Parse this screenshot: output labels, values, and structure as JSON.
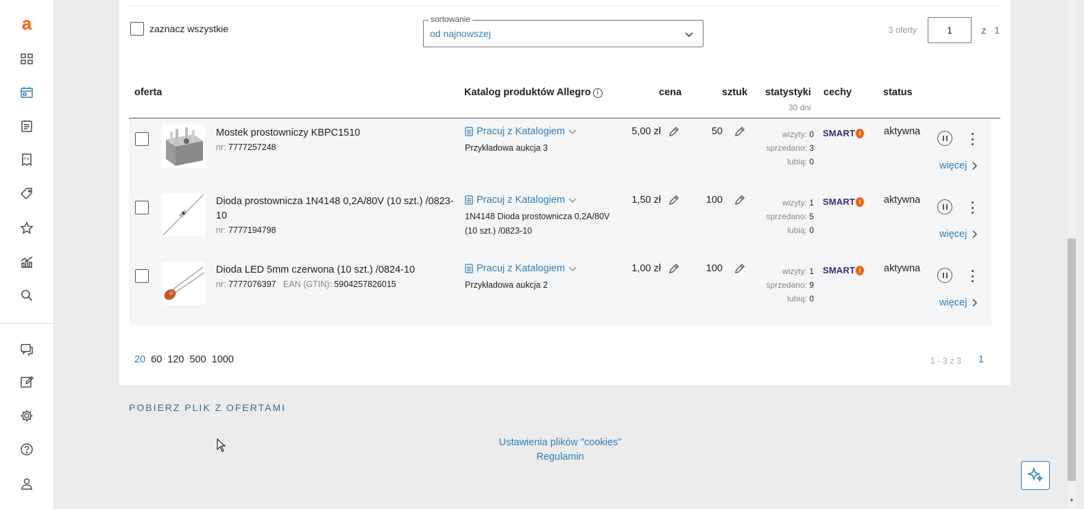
{
  "sidebar": {
    "logo": "a",
    "items": [
      {
        "name": "dashboard-icon"
      },
      {
        "name": "offers-icon"
      },
      {
        "name": "orders-icon"
      },
      {
        "name": "invoice-icon"
      },
      {
        "name": "tag-icon"
      },
      {
        "name": "star-icon"
      },
      {
        "name": "chart-icon"
      },
      {
        "name": "search-icon"
      },
      {
        "name": "messages-icon"
      },
      {
        "name": "edit-icon"
      },
      {
        "name": "gear-icon"
      },
      {
        "name": "help-icon"
      },
      {
        "name": "user-icon"
      }
    ],
    "active_index": 1,
    "accent_color": "#ff5a00"
  },
  "toolbar": {
    "select_all_label": "zaznacz wszystkie",
    "sort_label": "sortowanie",
    "sort_value": "od najnowszej",
    "offers_count": "3 oferty",
    "current_page": "1",
    "of_label": "z",
    "total_pages": "1"
  },
  "table": {
    "headers": {
      "offer": "oferta",
      "catalog": "Katalog produktów Allegro",
      "price": "cena",
      "quantity": "sztuk",
      "stats": "statystyki",
      "stats_sub": "30 dni",
      "features": "cechy",
      "status": "status"
    },
    "rows": [
      {
        "title": "Mostek prostowniczy KBPC1510",
        "nr_label": "nr:",
        "nr": "7777257248",
        "ean_label": "",
        "ean": "",
        "catalog_link": "Pracuj z Katalogiem",
        "catalog_desc": "Przykładowa aukcja 3",
        "price": "5,00 zł",
        "quantity": "50",
        "visits_label": "wizyty:",
        "visits": "0",
        "sold_label": "sprzedano:",
        "sold": "3",
        "likes_label": "lubią:",
        "likes": "0",
        "feature": "SMART",
        "status": "aktywna",
        "more": "więcej"
      },
      {
        "title": "Dioda prostownicza 1N4148 0,2A/80V (10 szt.) /0823-10",
        "nr_label": "nr:",
        "nr": "7777194798",
        "ean_label": "",
        "ean": "",
        "catalog_link": "Pracuj z Katalogiem",
        "catalog_desc": "1N4148 Dioda prostownicza 0,2A/80V (10 szt.) /0823-10",
        "price": "1,50 zł",
        "quantity": "100",
        "visits_label": "wizyty:",
        "visits": "1",
        "sold_label": "sprzedano:",
        "sold": "5",
        "likes_label": "lubią:",
        "likes": "0",
        "feature": "SMART",
        "status": "aktywna",
        "more": "więcej"
      },
      {
        "title": "Dioda LED 5mm czerwona (10 szt.) /0824-10",
        "nr_label": "nr:",
        "nr": "7777076397",
        "ean_label": "EAN (GTIN):",
        "ean": "5904257826015",
        "catalog_link": "Pracuj z Katalogiem",
        "catalog_desc": "Przykładowa aukcja 2",
        "price": "1,00 zł",
        "quantity": "100",
        "visits_label": "wizyty:",
        "visits": "1",
        "sold_label": "sprzedano:",
        "sold": "9",
        "likes_label": "lubią:",
        "likes": "0",
        "feature": "SMART",
        "status": "aktywna",
        "more": "więcej"
      }
    ]
  },
  "pagination": {
    "per_page_options": [
      "20",
      "60",
      "120",
      "500",
      "1000"
    ],
    "selected_per_page": "20",
    "range": "1 - 3 z 3",
    "page": "1"
  },
  "download_label": "POBIERZ PLIK Z OFERTAMI",
  "footer": {
    "cookies": "Ustawienia plików \"cookies\"",
    "terms": "Regulamin"
  },
  "colors": {
    "link": "#2f7fb8",
    "smart_badge": "#f06400",
    "row_bg": "#f5f6f8"
  }
}
